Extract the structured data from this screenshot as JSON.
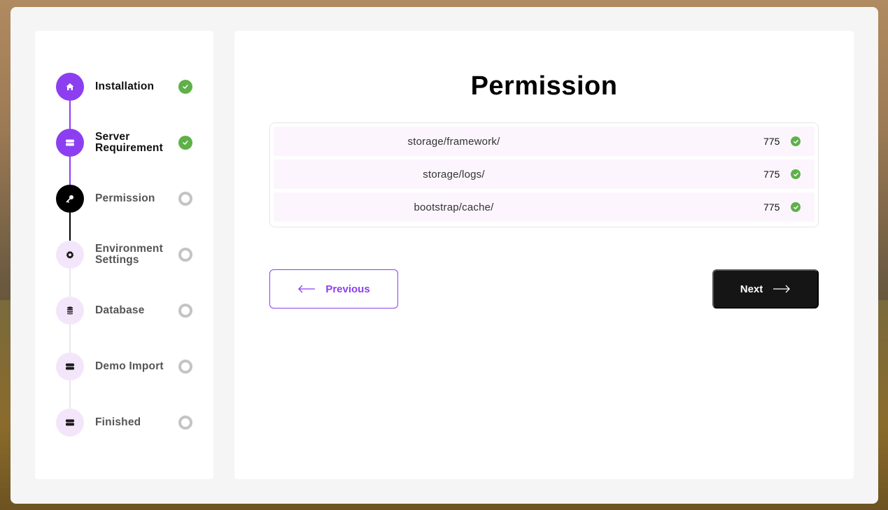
{
  "colors": {
    "accent": "#8c3ff0",
    "active": "#000000",
    "pending_bg": "#f3e6fb",
    "success": "#5fb049",
    "pending_status": "#c4c4c4",
    "row_bg": "#fcf5fe",
    "next_bg": "#151515"
  },
  "steps": [
    {
      "label": "Installation",
      "icon": "home-icon",
      "state": "done"
    },
    {
      "label": "Server Requirement",
      "icon": "server-icon",
      "state": "done"
    },
    {
      "label": "Permission",
      "icon": "key-icon",
      "state": "active"
    },
    {
      "label": "Environment Settings",
      "icon": "gear-icon",
      "state": "pending"
    },
    {
      "label": "Database",
      "icon": "database-icon",
      "state": "pending"
    },
    {
      "label": "Demo Import",
      "icon": "server-icon",
      "state": "pending"
    },
    {
      "label": "Finished",
      "icon": "server-icon",
      "state": "pending"
    }
  ],
  "main": {
    "title": "Permission",
    "permissions": [
      {
        "path": "storage/framework/",
        "value": "775",
        "status": "check-icon"
      },
      {
        "path": "storage/logs/",
        "value": "775",
        "status": "check-icon"
      },
      {
        "path": "bootstrap/cache/",
        "value": "775",
        "status": "check-icon"
      }
    ],
    "previous_label": "Previous",
    "next_label": "Next"
  }
}
